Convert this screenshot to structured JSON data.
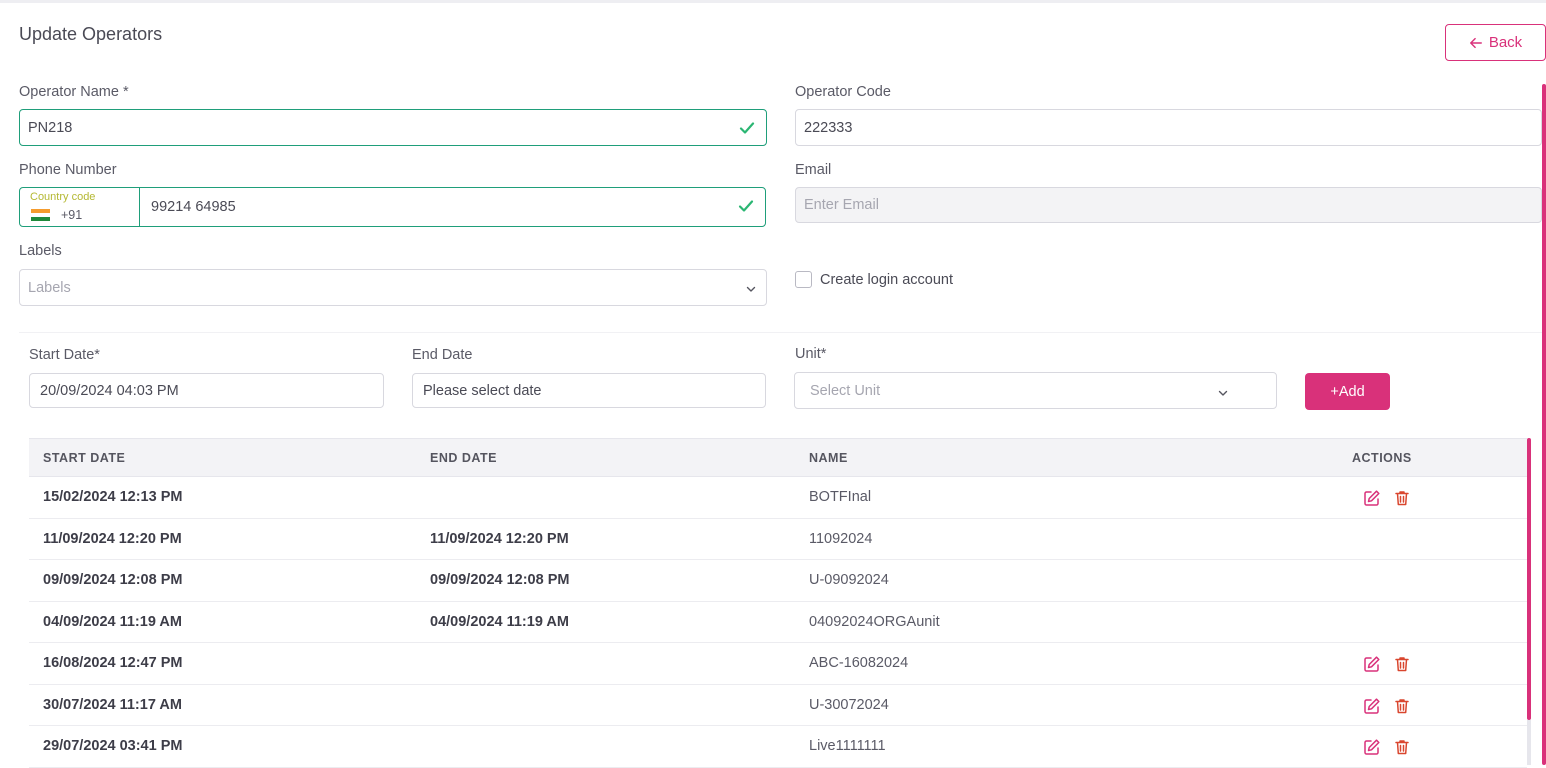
{
  "page": {
    "title": "Update Operators",
    "back_label": "Back"
  },
  "form": {
    "operator_name": {
      "label": "Operator Name *",
      "value": "PN218"
    },
    "operator_code": {
      "label": "Operator Code",
      "value": "222333"
    },
    "phone": {
      "label": "Phone Number",
      "country_code_label": "Country code",
      "country_code": "+91",
      "number": "99214 64985"
    },
    "email": {
      "label": "Email",
      "placeholder": "Enter Email"
    },
    "labels": {
      "label": "Labels",
      "placeholder": "Labels"
    },
    "create_login": {
      "label": "Create login account",
      "checked": false
    }
  },
  "unit_form": {
    "start_date": {
      "label": "Start Date*",
      "value": "20/09/2024 04:03 PM"
    },
    "end_date": {
      "label": "End Date",
      "placeholder": "Please select date"
    },
    "unit": {
      "label": "Unit*",
      "placeholder": "Select Unit"
    },
    "add_label": "+Add"
  },
  "table": {
    "headers": [
      "START DATE",
      "END DATE",
      "NAME",
      "ACTIONS"
    ],
    "rows": [
      {
        "start": "15/02/2024 12:13 PM",
        "end": "",
        "name": "BOTFInal",
        "actions": true
      },
      {
        "start": "11/09/2024 12:20 PM",
        "end": "11/09/2024 12:20 PM",
        "name": "11092024",
        "actions": false
      },
      {
        "start": "09/09/2024 12:08 PM",
        "end": "09/09/2024 12:08 PM",
        "name": "U-09092024",
        "actions": false
      },
      {
        "start": "04/09/2024 11:19 AM",
        "end": "04/09/2024 11:19 AM",
        "name": "04092024ORGAunit",
        "actions": false
      },
      {
        "start": "16/08/2024 12:47 PM",
        "end": "",
        "name": "ABC-16082024",
        "actions": true
      },
      {
        "start": "30/07/2024 11:17 AM",
        "end": "",
        "name": "U-30072024",
        "actions": true
      },
      {
        "start": "29/07/2024 03:41 PM",
        "end": "",
        "name": "Live1111111",
        "actions": true
      }
    ]
  },
  "colors": {
    "accent": "#d9317a",
    "valid": "#1f9e7a",
    "check": "#2bb673",
    "delete": "#d9462e"
  },
  "icons": {
    "back": "arrow-left-icon",
    "valid": "check-icon",
    "dropdown": "chevron-down-icon",
    "edit": "edit-icon",
    "delete": "trash-icon"
  }
}
